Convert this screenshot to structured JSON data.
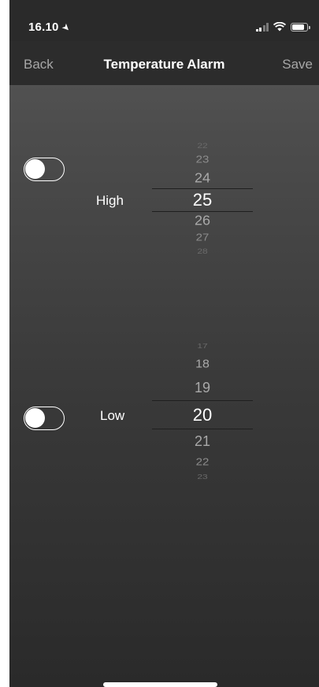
{
  "status_bar": {
    "time": "16.10",
    "location_glyph": "➤",
    "icons": [
      "signal-icon",
      "wifi-icon",
      "battery-icon"
    ]
  },
  "nav": {
    "back_label": "Back",
    "title": "Temperature Alarm",
    "save_label": "Save"
  },
  "alarms": {
    "high": {
      "label": "High",
      "enabled": false,
      "picker_values": [
        "22",
        "23",
        "24",
        "25",
        "26",
        "27",
        "28"
      ],
      "selected": "25"
    },
    "low": {
      "label": "Low",
      "enabled": false,
      "picker_values": [
        "17",
        "18",
        "19",
        "20",
        "21",
        "22",
        "23"
      ],
      "selected": "20"
    }
  },
  "colors": {
    "nav_background": "#2c2c2c",
    "text_primary": "#ffffff",
    "text_secondary": "#a7a7a7"
  }
}
